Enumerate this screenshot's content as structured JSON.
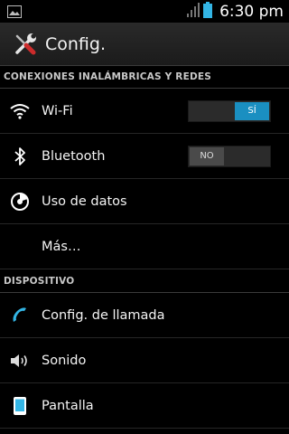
{
  "status_bar": {
    "time": "6:30 pm",
    "left_icon": "gallery-icon",
    "signal_icon": "signal-icon",
    "battery_icon": "battery-icon",
    "battery_color": "#33b5e5"
  },
  "action_bar": {
    "title": "Config.",
    "icon": "settings-tools-icon"
  },
  "sections": [
    {
      "header": "CONEXIONES INALÁMBRICAS Y REDES"
    },
    {
      "header": "DISPOSITIVO"
    }
  ],
  "items": {
    "wifi": {
      "label": "Wi-Fi",
      "icon": "wifi-icon",
      "toggle": {
        "state": "on",
        "text": "SÍ"
      }
    },
    "bluetooth": {
      "label": "Bluetooth",
      "icon": "bluetooth-icon",
      "toggle": {
        "state": "off",
        "text": "NO"
      }
    },
    "data_usage": {
      "label": "Uso de datos",
      "icon": "data-usage-icon"
    },
    "more": {
      "label": "Más…"
    },
    "call_settings": {
      "label": "Config. de llamada",
      "icon": "phone-icon"
    },
    "sound": {
      "label": "Sonido",
      "icon": "speaker-icon"
    },
    "display": {
      "label": "Pantalla",
      "icon": "display-icon"
    }
  },
  "colors": {
    "accent": "#1a8fc1",
    "divider": "#262626"
  }
}
